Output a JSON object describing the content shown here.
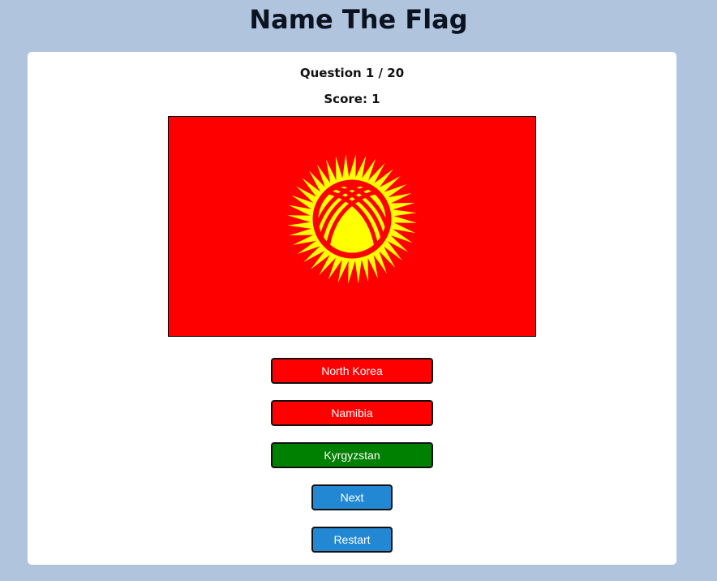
{
  "header": {
    "title": "Name The Flag"
  },
  "quiz": {
    "question_label": "Question 1 / 20",
    "score_label": "Score: 1"
  },
  "flag": {
    "icon": "kyrgyzstan-flag",
    "colors": {
      "field": "#ff0000",
      "sun": "#ffff00",
      "tunduk": "#ff0000"
    }
  },
  "options": [
    {
      "label": "North Korea",
      "state": "wrong",
      "color": "#ff0000"
    },
    {
      "label": "Namibia",
      "state": "wrong",
      "color": "#ff0000"
    },
    {
      "label": "Kyrgyzstan",
      "state": "correct",
      "color": "#008000"
    }
  ],
  "controls": {
    "next_label": "Next",
    "restart_label": "Restart",
    "color": "#2288d3"
  },
  "theme": {
    "page_background": "#b0c4de",
    "card_background": "#ffffff"
  }
}
